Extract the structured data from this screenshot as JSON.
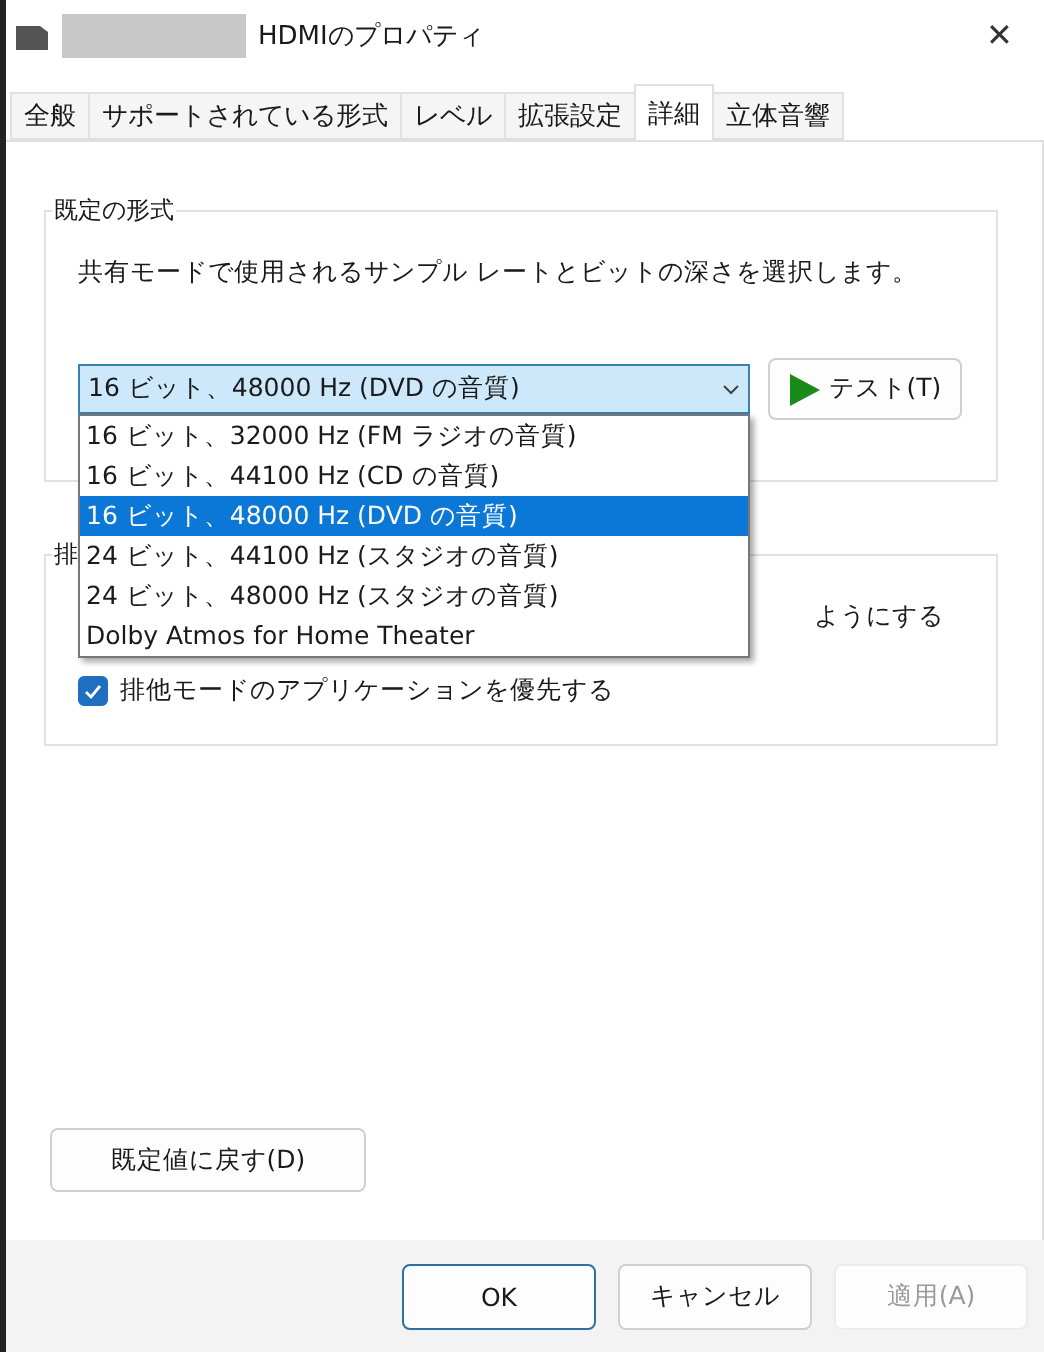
{
  "window": {
    "title": "HDMIのプロパティ",
    "close": "✕"
  },
  "tabs": [
    {
      "label": "全般",
      "selected": false
    },
    {
      "label": "サポートされている形式",
      "selected": false
    },
    {
      "label": "レベル",
      "selected": false
    },
    {
      "label": "拡張設定",
      "selected": false
    },
    {
      "label": "詳細",
      "selected": true
    },
    {
      "label": "立体音響",
      "selected": false
    }
  ],
  "default_format": {
    "title": "既定の形式",
    "description": "共有モードで使用されるサンプル レートとビットの深さを選択します。",
    "combo": {
      "value": "16 ビット、48000 Hz (DVD の音質)",
      "expanded": true,
      "options": [
        {
          "label": "16 ビット、32000 Hz (FM ラジオの音質)",
          "selected": false
        },
        {
          "label": "16 ビット、44100 Hz (CD の音質)",
          "selected": false
        },
        {
          "label": "16 ビット、48000 Hz (DVD の音質)",
          "selected": true
        },
        {
          "label": "24 ビット、44100 Hz (スタジオの音質)",
          "selected": false
        },
        {
          "label": "24 ビット、48000 Hz (スタジオの音質)",
          "selected": false
        },
        {
          "label": "Dolby Atmos for Home Theater",
          "selected": false
        }
      ]
    },
    "test_button": "テスト(T)"
  },
  "exclusive_mode": {
    "title": "排",
    "options": [
      {
        "label": "ようにする",
        "kind": "partial"
      },
      {
        "label": "排他モードのアプリケーションを優先する",
        "kind": "checkbox",
        "checked": true
      }
    ]
  },
  "reset_button": "既定値に戻す(D)",
  "buttons": [
    {
      "label": "OK",
      "disabled": false,
      "default": true
    },
    {
      "label": "キャンセル",
      "disabled": false,
      "default": false
    },
    {
      "label": "適用(A)",
      "disabled": true,
      "default": false
    }
  ]
}
